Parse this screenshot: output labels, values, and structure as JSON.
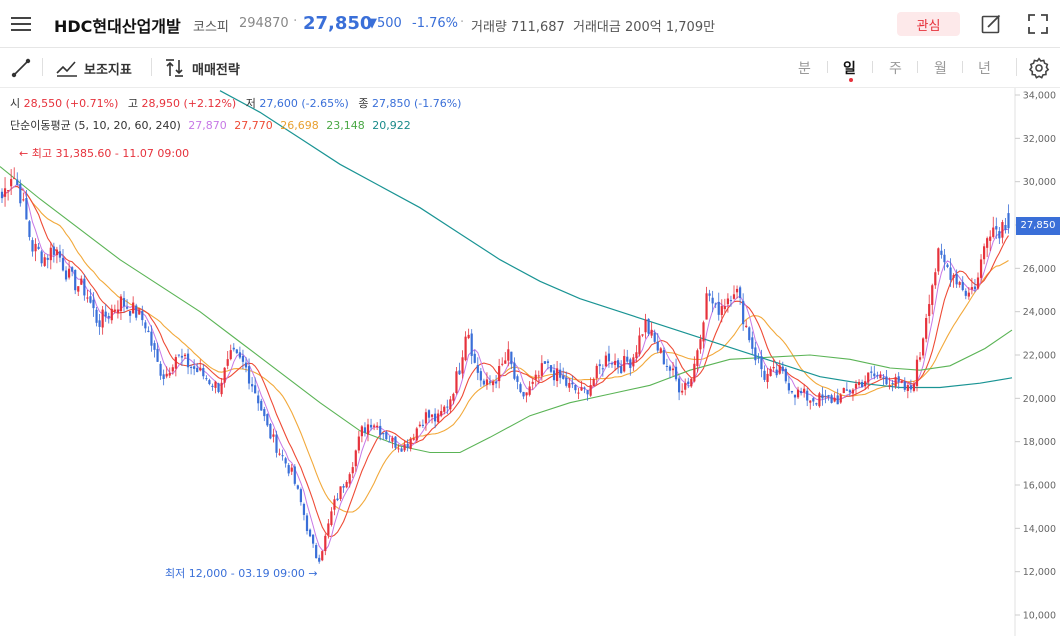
{
  "header": {
    "menu_icon": "hamburger-icon",
    "stock_name": "HDC현대산업개발",
    "market": "코스피",
    "code": "294870",
    "separator": "·",
    "price": "27,850",
    "change": "▼500",
    "change_pct": "-1.76%",
    "volume": "거래량 711,687",
    "amount": "거래대금 200억 1,709만",
    "favorite_label": "관심",
    "edit_icon": "edit-icon",
    "fullscreen_icon": "fullscreen-icon"
  },
  "toolbar": {
    "draw_icon": "line-draw-icon",
    "indicator_label": "보조지표",
    "strategy_label": "매매전략",
    "periods": [
      "분",
      "일",
      "주",
      "월",
      "년"
    ],
    "active_period": "일",
    "settings_icon": "gear-icon"
  },
  "info": {
    "open_label": "시",
    "open_value": "28,550 (+0.71%)",
    "high_label": "고",
    "high_value": "28,950 (+2.12%)",
    "low_label": "저",
    "low_value": "27,600 (-2.65%)",
    "close_label": "종",
    "close_value": "27,850 (-1.76%)",
    "ma_label": "단순이동평균 (5, 10, 20, 60, 240)",
    "ma_values": [
      "27,870",
      "27,770",
      "26,698",
      "23,148",
      "20,922"
    ]
  },
  "colors": {
    "up": "#e6323c",
    "down": "#3a6fd8",
    "ma5": "#c779e6",
    "ma10": "#ee4b36",
    "ma20": "#f2a93b",
    "ma60": "#5bb456",
    "ma240": "#1a9494"
  },
  "chart_data": {
    "type": "candlestick",
    "y_axis_ticks": [
      "34,000",
      "32,000",
      "30,000",
      "28,000",
      "26,000",
      "24,000",
      "22,000",
      "20,000",
      "18,000",
      "16,000",
      "14,000",
      "12,000",
      "10,000"
    ],
    "ylim": [
      10000,
      34000
    ],
    "current_price_tag": "27,850",
    "annotations": {
      "high": "← 최고 31,385.60 - 11.07 09:00",
      "low": "최저 12,000 - 03.19 09:00 →"
    },
    "close_path": [
      [
        0,
        29000
      ],
      [
        12,
        30500
      ],
      [
        20,
        29500
      ],
      [
        32,
        27000
      ],
      [
        45,
        26500
      ],
      [
        55,
        27000
      ],
      [
        60,
        26500
      ],
      [
        70,
        25500
      ],
      [
        85,
        25000
      ],
      [
        98,
        23500
      ],
      [
        110,
        24000
      ],
      [
        120,
        24500
      ],
      [
        135,
        24000
      ],
      [
        145,
        23500
      ],
      [
        158,
        21500
      ],
      [
        165,
        21000
      ],
      [
        175,
        22000
      ],
      [
        190,
        21500
      ],
      [
        205,
        21000
      ],
      [
        218,
        20500
      ],
      [
        232,
        22000
      ],
      [
        245,
        21500
      ],
      [
        258,
        20000
      ],
      [
        268,
        18500
      ],
      [
        280,
        17500
      ],
      [
        292,
        16500
      ],
      [
        302,
        15000
      ],
      [
        310,
        13500
      ],
      [
        318,
        12500
      ],
      [
        325,
        13500
      ],
      [
        333,
        15000
      ],
      [
        343,
        16000
      ],
      [
        352,
        17000
      ],
      [
        362,
        18500
      ],
      [
        372,
        19000
      ],
      [
        382,
        18500
      ],
      [
        392,
        18000
      ],
      [
        405,
        17800
      ],
      [
        415,
        18500
      ],
      [
        425,
        19200
      ],
      [
        438,
        19000
      ],
      [
        450,
        20000
      ],
      [
        460,
        21500
      ],
      [
        467,
        23500
      ],
      [
        475,
        21500
      ],
      [
        485,
        20500
      ],
      [
        497,
        21000
      ],
      [
        508,
        22000
      ],
      [
        520,
        20000
      ],
      [
        532,
        20500
      ],
      [
        545,
        21500
      ],
      [
        558,
        21000
      ],
      [
        570,
        20500
      ],
      [
        583,
        20200
      ],
      [
        595,
        21000
      ],
      [
        608,
        22000
      ],
      [
        620,
        21500
      ],
      [
        632,
        21800
      ],
      [
        645,
        23500
      ],
      [
        655,
        22500
      ],
      [
        668,
        21500
      ],
      [
        680,
        20500
      ],
      [
        692,
        21000
      ],
      [
        700,
        23000
      ],
      [
        708,
        25000
      ],
      [
        715,
        24000
      ],
      [
        725,
        24500
      ],
      [
        735,
        25200
      ],
      [
        745,
        23500
      ],
      [
        755,
        22000
      ],
      [
        765,
        21000
      ],
      [
        780,
        21200
      ],
      [
        795,
        20300
      ],
      [
        810,
        20000
      ],
      [
        825,
        19900
      ],
      [
        840,
        20000
      ],
      [
        855,
        20600
      ],
      [
        870,
        21000
      ],
      [
        885,
        21000
      ],
      [
        898,
        20600
      ],
      [
        910,
        20300
      ],
      [
        920,
        22000
      ],
      [
        928,
        24500
      ],
      [
        938,
        26500
      ],
      [
        948,
        26000
      ],
      [
        958,
        25500
      ],
      [
        968,
        24800
      ],
      [
        978,
        25500
      ],
      [
        988,
        28000
      ],
      [
        998,
        27800
      ],
      [
        1008,
        28300
      ],
      [
        1012,
        27850
      ]
    ],
    "ma240_path": [
      [
        220,
        34200
      ],
      [
        260,
        33200
      ],
      [
        300,
        32000
      ],
      [
        340,
        30800
      ],
      [
        380,
        29800
      ],
      [
        420,
        28800
      ],
      [
        460,
        27600
      ],
      [
        500,
        26400
      ],
      [
        540,
        25400
      ],
      [
        580,
        24600
      ],
      [
        620,
        24000
      ],
      [
        660,
        23400
      ],
      [
        700,
        22800
      ],
      [
        740,
        22200
      ],
      [
        780,
        21600
      ],
      [
        820,
        21000
      ],
      [
        860,
        20700
      ],
      [
        900,
        20500
      ],
      [
        940,
        20500
      ],
      [
        980,
        20700
      ],
      [
        1012,
        20950
      ]
    ],
    "ma60_path": [
      [
        0,
        30700
      ],
      [
        40,
        29200
      ],
      [
        80,
        27800
      ],
      [
        120,
        26400
      ],
      [
        160,
        25200
      ],
      [
        200,
        24000
      ],
      [
        240,
        22600
      ],
      [
        280,
        21200
      ],
      [
        320,
        19800
      ],
      [
        360,
        18500
      ],
      [
        400,
        17800
      ],
      [
        430,
        17500
      ],
      [
        460,
        17500
      ],
      [
        490,
        18200
      ],
      [
        530,
        19200
      ],
      [
        570,
        19800
      ],
      [
        610,
        20200
      ],
      [
        650,
        20600
      ],
      [
        690,
        21300
      ],
      [
        730,
        21800
      ],
      [
        770,
        21900
      ],
      [
        810,
        22000
      ],
      [
        850,
        21800
      ],
      [
        890,
        21400
      ],
      [
        920,
        21300
      ],
      [
        950,
        21500
      ],
      [
        985,
        22300
      ],
      [
        1012,
        23150
      ]
    ]
  }
}
